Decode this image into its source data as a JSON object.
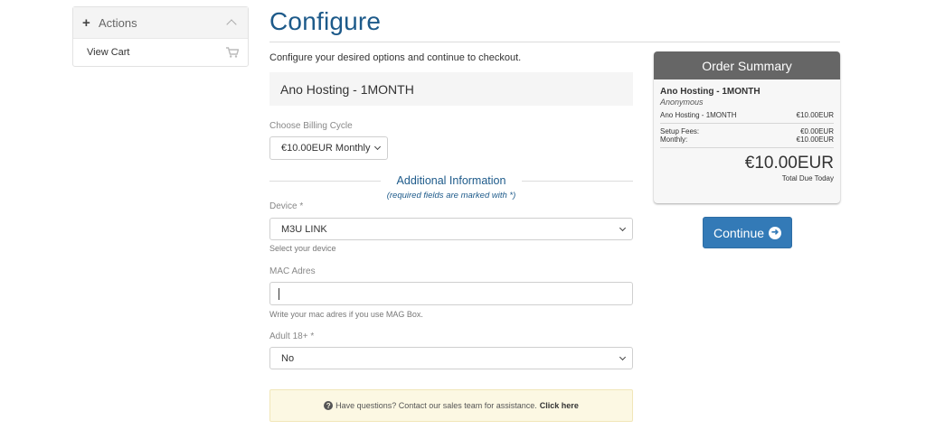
{
  "sidebar": {
    "title": "Actions",
    "items": [
      {
        "label": "View Cart",
        "icon": "cart-icon"
      }
    ]
  },
  "page": {
    "title": "Configure",
    "intro": "Configure your desired options and continue to checkout.",
    "product_name": "Ano Hosting - 1MONTH"
  },
  "billing": {
    "label": "Choose Billing Cycle",
    "selected": "€10.00EUR Monthly"
  },
  "additional": {
    "heading": "Additional Information",
    "subheading": "(required fields are marked with *)"
  },
  "fields": {
    "device": {
      "label": "Device *",
      "selected": "M3U LINK",
      "help": "Select your device"
    },
    "mac": {
      "label": "MAC Adres",
      "value": "",
      "help": "Write your mac adres if you use MAG Box."
    },
    "adult": {
      "label": "Adult 18+ *",
      "selected": "No"
    }
  },
  "notice": {
    "text": "Have questions? Contact our sales team for assistance.",
    "link": "Click here"
  },
  "summary": {
    "title": "Order Summary",
    "product": "Ano Hosting - 1MONTH",
    "group": "Anonymous",
    "line_item": {
      "label": "Ano Hosting - 1MONTH",
      "value": "€10.00EUR"
    },
    "setup": {
      "label": "Setup Fees:",
      "value": "€0.00EUR"
    },
    "monthly": {
      "label": "Monthly:",
      "value": "€10.00EUR"
    },
    "total": "€10.00EUR",
    "total_label": "Total Due Today"
  },
  "continue_label": "Continue",
  "colors": {
    "accent": "#1d5a8a",
    "button": "#337ab7",
    "summary_header": "#666666",
    "notice_bg": "#fcf8e3"
  }
}
